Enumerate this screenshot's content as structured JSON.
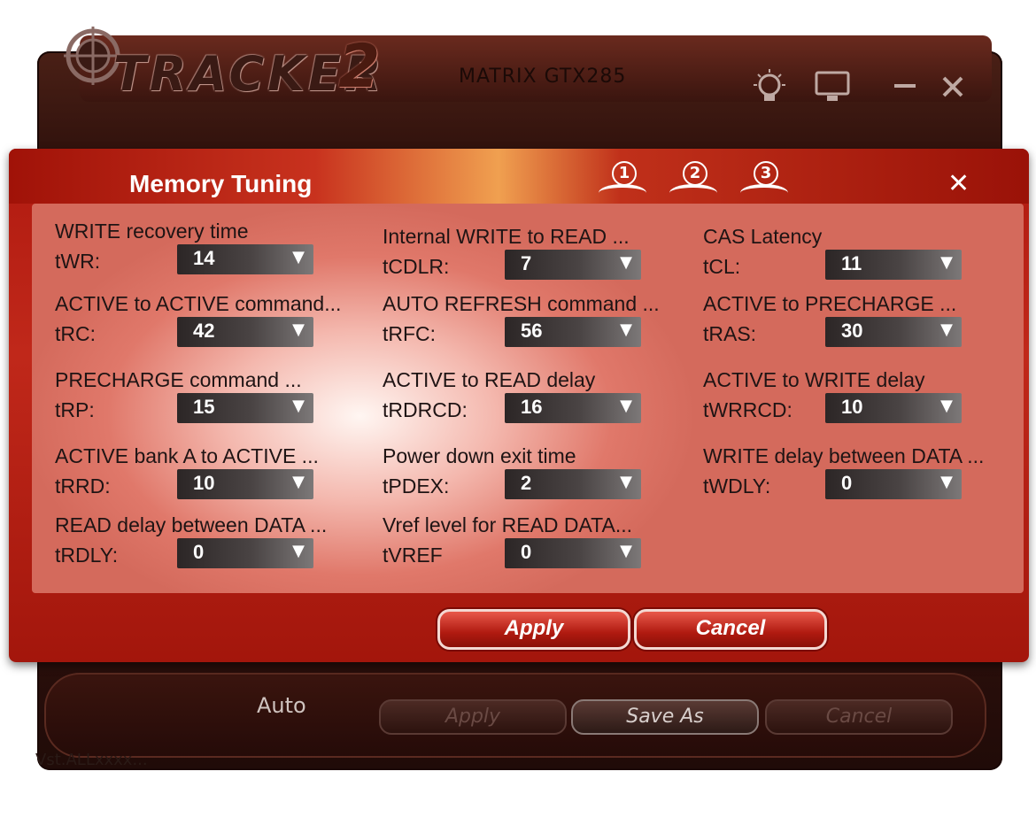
{
  "app": {
    "name": "TRACKER",
    "version_mark": "2",
    "model": "MATRIX GTX285"
  },
  "background": {
    "mode_label": "Auto",
    "buttons": {
      "apply": "Apply",
      "save_as": "Save As",
      "cancel": "Cancel"
    },
    "status": "Vst.ALLxxxx..."
  },
  "dialog": {
    "title": "Memory Tuning",
    "steps": [
      "1",
      "2",
      "3"
    ],
    "close": "✕",
    "fields": [
      {
        "label": "WRITE recovery time",
        "abbr": "tWR:",
        "value": "14"
      },
      {
        "label": "Internal WRITE to READ ...",
        "abbr": "tCDLR:",
        "value": "7"
      },
      {
        "label": "CAS Latency",
        "abbr": "tCL:",
        "value": "11"
      },
      {
        "label": "ACTIVE to ACTIVE command...",
        "abbr": "tRC:",
        "value": "42"
      },
      {
        "label": "AUTO REFRESH command ...",
        "abbr": "tRFC:",
        "value": "56"
      },
      {
        "label": "ACTIVE to PRECHARGE ...",
        "abbr": "tRAS:",
        "value": "30"
      },
      {
        "label": "PRECHARGE command ...",
        "abbr": "tRP:",
        "value": "15"
      },
      {
        "label": "ACTIVE to READ delay",
        "abbr": "tRDRCD:",
        "value": "16"
      },
      {
        "label": "ACTIVE to WRITE delay",
        "abbr": "tWRRCD:",
        "value": "10"
      },
      {
        "label": "ACTIVE bank A to ACTIVE ...",
        "abbr": "tRRD:",
        "value": "10"
      },
      {
        "label": "Power down exit time",
        "abbr": "tPDEX:",
        "value": "2"
      },
      {
        "label": "WRITE delay between DATA ...",
        "abbr": "tWDLY:",
        "value": "0"
      },
      {
        "label": "READ delay between DATA ...",
        "abbr": "tRDLY:",
        "value": "0"
      },
      {
        "label": "Vref level for READ DATA...",
        "abbr": "tVREF",
        "value": "0"
      }
    ],
    "apply_label": "Apply",
    "cancel_label": "Cancel"
  }
}
